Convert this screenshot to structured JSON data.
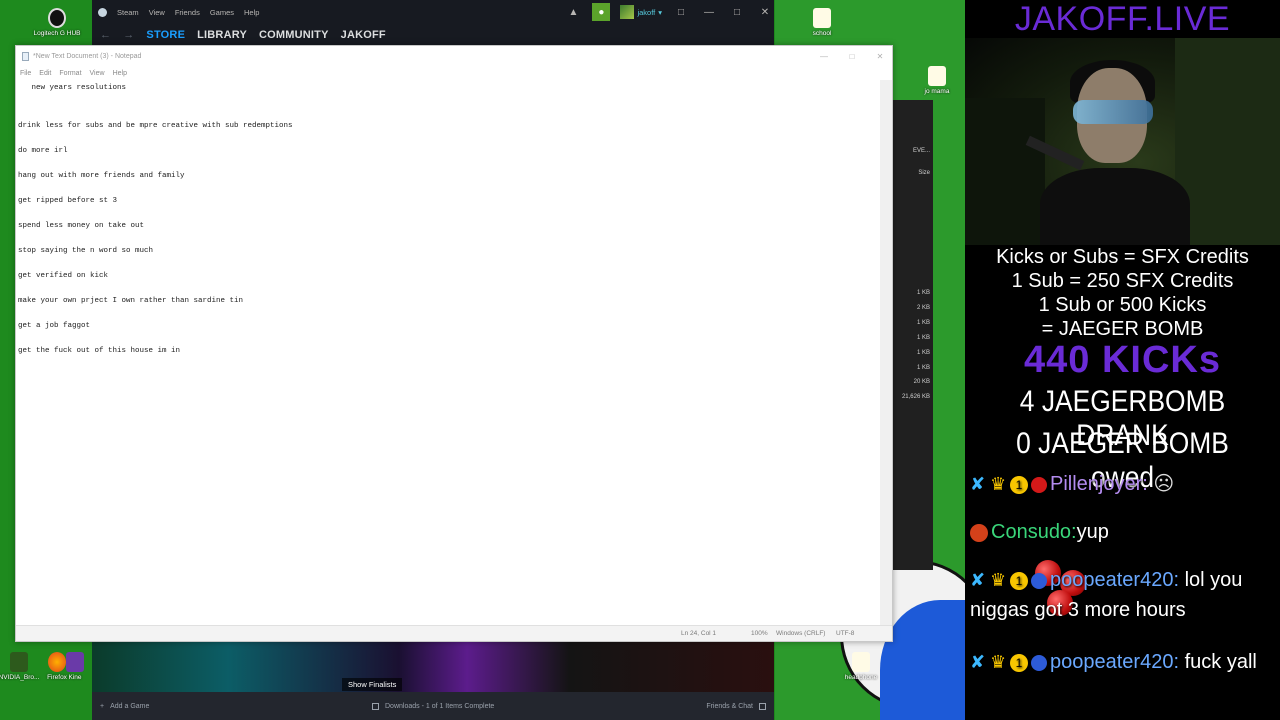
{
  "desktop": {
    "icons": [
      {
        "name": "Logitech G Hub",
        "label": "Logitech G HUB"
      },
      {
        "name": "school",
        "label": "school"
      },
      {
        "name": "jo-mama",
        "label": "jo mama"
      },
      {
        "name": "nvidia",
        "label": "NVIDIA_Bro..."
      },
      {
        "name": "firefox",
        "label": "Firefox"
      },
      {
        "name": "kinect",
        "label": "Kine"
      },
      {
        "name": "headphone",
        "label": "headphone"
      }
    ]
  },
  "steam": {
    "menu": [
      "Steam",
      "View",
      "Friends",
      "Games",
      "Help"
    ],
    "username": "jakoff",
    "nav": [
      "STORE",
      "LIBRARY",
      "COMMUNITY",
      "JAKOFF"
    ],
    "active_nav": "STORE",
    "show_finalists": "Show Finalists",
    "footer": {
      "add_game": "Add a Game",
      "downloads": "Downloads - 1 of 1 Items Complete",
      "friends_chat": "Friends & Chat"
    }
  },
  "explorer": {
    "size_header": "Size",
    "search_text": "EVE...",
    "sizes": [
      "1 KB",
      "2 KB",
      "1 KB",
      "1 KB",
      "1 KB",
      "1 KB",
      "20 KB",
      "21,626 KB"
    ]
  },
  "notepad": {
    "title": "*New Text Document (3) - Notepad",
    "menu": [
      "File",
      "Edit",
      "Format",
      "View",
      "Help"
    ],
    "lines": [
      "   new years resolutions",
      "drink less for subs and be mpre creative with sub redemptions",
      "do more irl",
      "hang out with more friends and family",
      "get ripped before st 3",
      "spend less money on take out",
      "stop saying the n word so much",
      "get verified on kick",
      "make your own prject I own rather than sardine tin",
      "get a job faggot",
      "get the fuck out of this house im in"
    ],
    "status": {
      "position": "Ln 24, Col 1",
      "zoom": "100%",
      "line_ending": "Windows (CRLF)",
      "encoding": "UTF-8"
    }
  },
  "overlay": {
    "title": "JAKOFF.LIVE",
    "info": [
      "Kicks or Subs = SFX Credits",
      "1 Sub = 250 SFX Credits",
      "1 Sub or 500 Kicks",
      "= JAEGER BOMB"
    ],
    "kicks": "440 KICKs",
    "drank": "4 JAEGERBOMB DRANK",
    "owed": "0 JAEGER BOMB owed",
    "chat": [
      {
        "user": "Pillenjoyer:",
        "message": "",
        "user_color": "#b48cf0"
      },
      {
        "user": "Consudo:",
        "message": "yup",
        "user_color": "#3ad67a"
      },
      {
        "user": "poopeater420:",
        "message": "lol you niggas got 3 more hours",
        "user_color": "#6aa8ff"
      },
      {
        "user": "poopeater420:",
        "message": "fuck yall",
        "user_color": "#6aa8ff"
      }
    ],
    "badge_number": "1"
  },
  "colors": {
    "steam_active": "#1a9fff",
    "overlay_purple": "#6a2bd6",
    "desktop_green": "#1e8a1e"
  }
}
